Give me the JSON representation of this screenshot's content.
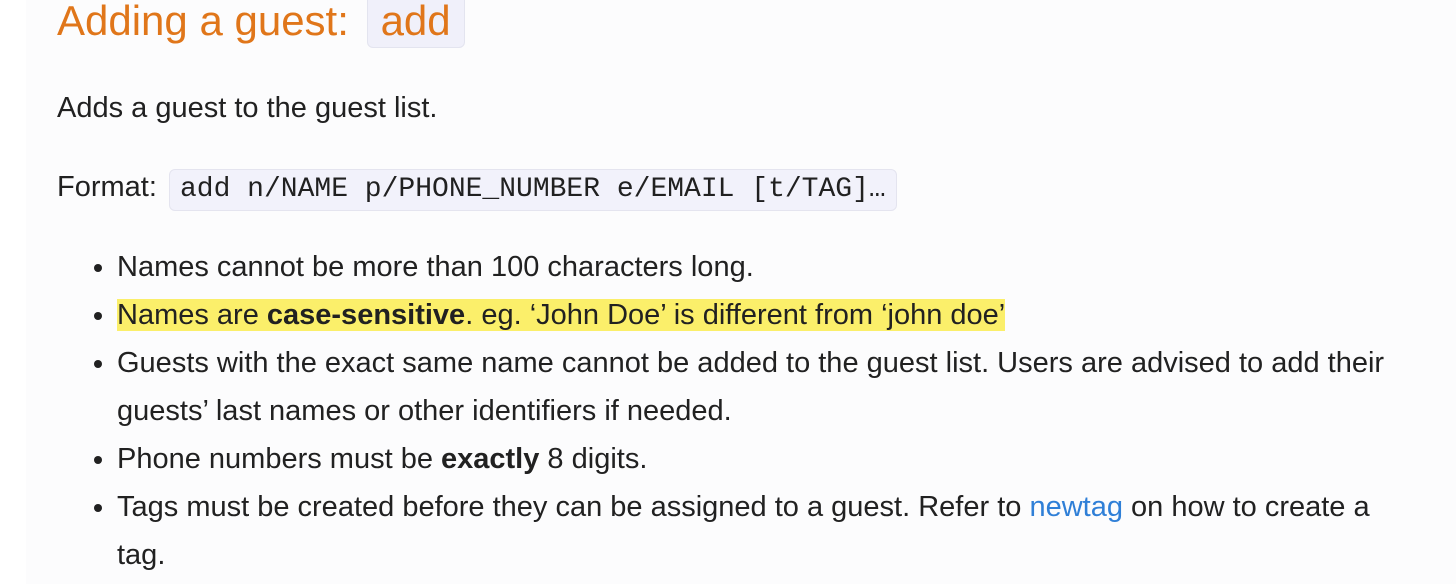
{
  "section": {
    "heading_text": "Adding a guest:",
    "heading_code": "add"
  },
  "description": "Adds a guest to the guest list.",
  "format": {
    "label": "Format:",
    "code": "add n/NAME p/PHONE_NUMBER e/EMAIL [t/TAG]…"
  },
  "rules": {
    "r1": "Names cannot be more than 100 characters long.",
    "r2": {
      "pre": "Names are ",
      "bold": "case-sensitive",
      "post": ". eg. ‘John Doe’ is different from ‘john doe’"
    },
    "r3": "Guests with the exact same name cannot be added to the guest list. Users are advised to add their guests’ last names or other identifiers if needed.",
    "r4": {
      "pre": "Phone numbers must be ",
      "bold": "exactly",
      "post": " 8 digits."
    },
    "r5": {
      "pre": "Tags must be created before they can be assigned to a guest. Refer to ",
      "link": "newtag",
      "post": " on how to create a tag."
    }
  },
  "colors": {
    "heading": "#e0761a",
    "highlight": "#fbef6a",
    "link": "#2f7fd7"
  }
}
